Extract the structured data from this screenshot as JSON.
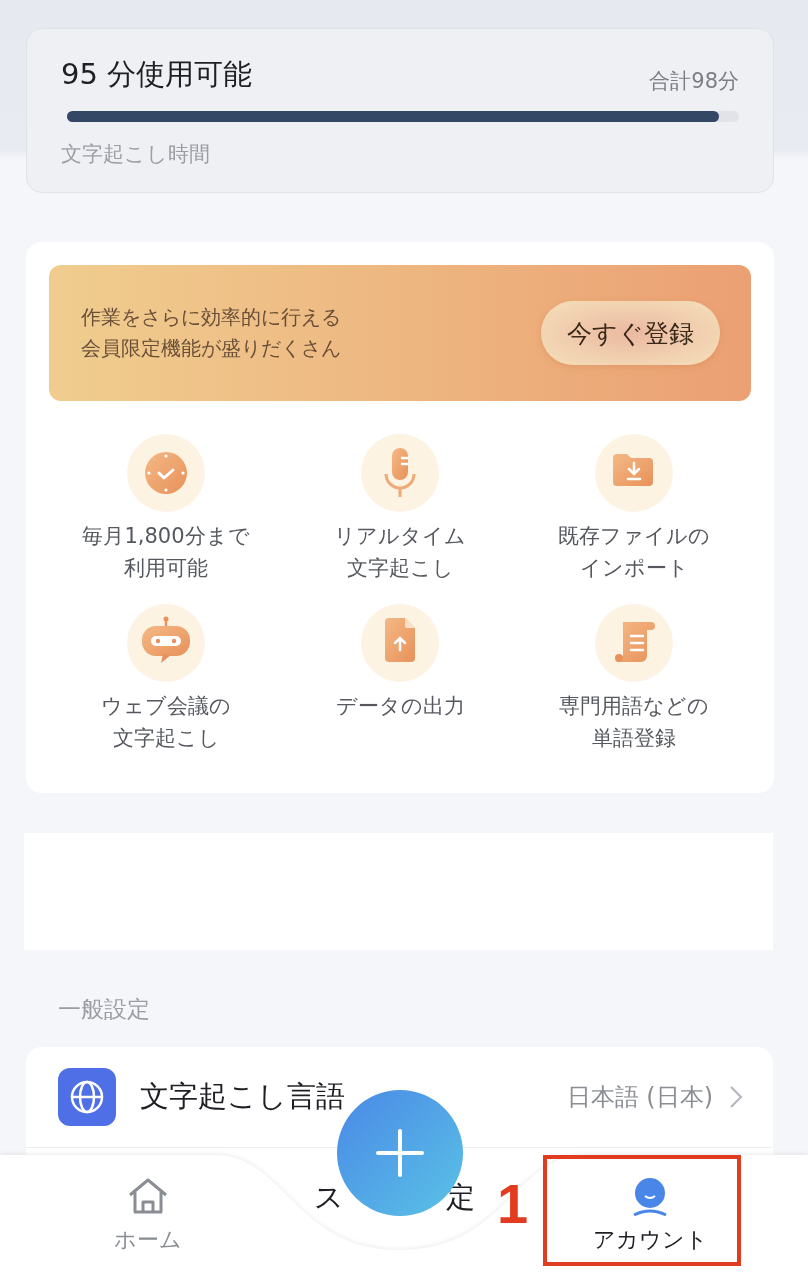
{
  "usage": {
    "title": "95 分使用可能",
    "total": "合計98分",
    "level": 0.97,
    "caption": "文字起こし時間"
  },
  "promo": {
    "lines": [
      "作業をさらに効率的に行える",
      "会員限定機能が盛りだくさん"
    ],
    "button": "今すぐ登録"
  },
  "features": [
    {
      "lines": [
        "毎月1,800分まで",
        "利用可能"
      ]
    },
    {
      "lines": [
        "リアルタイム",
        "文字起こし"
      ]
    },
    {
      "lines": [
        "既存ファイルの",
        "インポート"
      ]
    },
    {
      "lines": [
        "ウェブ会議の",
        "文字起こし"
      ]
    },
    {
      "lines": [
        "データの出力"
      ]
    },
    {
      "lines": [
        "専門用語などの",
        "単語登録"
      ]
    }
  ],
  "section_title": "一般設定",
  "settings": [
    {
      "label": "文字起こし言語",
      "value": "日本語 (日本)"
    }
  ],
  "hidden_row_parts": [
    "ス",
    "定"
  ],
  "tabs": [
    {
      "label": "ホーム",
      "selected": false
    },
    {
      "label": "アカウント",
      "selected": true
    }
  ],
  "annotation": {
    "label": "1"
  }
}
